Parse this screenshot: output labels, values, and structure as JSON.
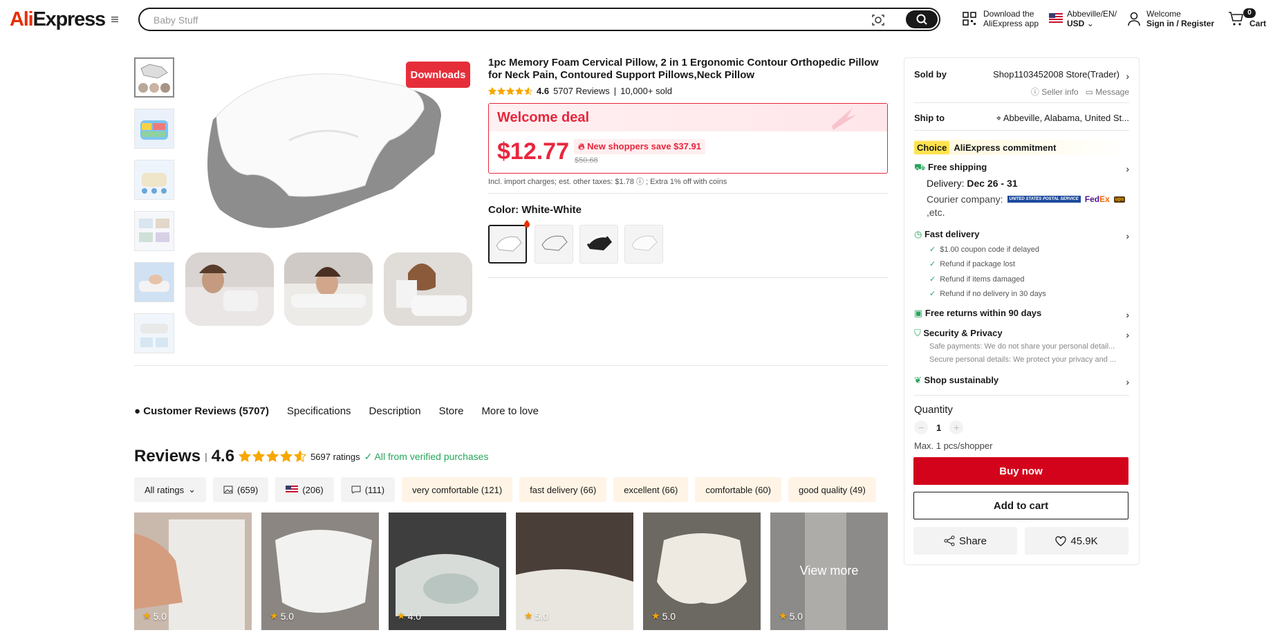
{
  "header": {
    "logo_a": "Ali",
    "logo_b": "Express",
    "search_placeholder": "Baby Stuff",
    "download_line1": "Download the",
    "download_line2": "AliExpress app",
    "region_line1": "Abbeville/EN/",
    "region_line2": "USD",
    "welcome": "Welcome",
    "signin": "Sign in / Register",
    "cart_count": "0",
    "cart_label": "Cart"
  },
  "gallery": {
    "downloads_label": "Downloads"
  },
  "product": {
    "title": "1pc Memory Foam Cervical Pillow, 2 in 1 Ergonomic Contour Orthopedic Pillow for Neck Pain, Contoured Support Pillows,Neck Pillow",
    "rating": "4.6",
    "rating_value": 4.6,
    "reviews": "5707 Reviews",
    "sold": "10,000+ sold",
    "deal_title": "Welcome deal",
    "price": "$12.77",
    "save_text": "New shoppers save $37.91",
    "old_price": "$50.68",
    "tax_note": "Incl. import charges; est. other taxes: $1.78 ⓘ ; Extra 1% off with coins",
    "color_label": "Color: White-White"
  },
  "tabs": [
    {
      "label": "Customer Reviews (5707)"
    },
    {
      "label": "Specifications"
    },
    {
      "label": "Description"
    },
    {
      "label": "Store"
    },
    {
      "label": "More to love"
    }
  ],
  "reviews": {
    "heading": "Reviews",
    "sep": "|",
    "rating": "4.6",
    "ratings_count": "5697 ratings",
    "verified": "All from verified purchases",
    "filters": [
      {
        "label": "All ratings",
        "kind": "select"
      },
      {
        "label": "(659)",
        "icon": "image-icon"
      },
      {
        "label": "(206)",
        "icon": "us-flag-icon"
      },
      {
        "label": "(111)",
        "icon": "comment-icon"
      },
      {
        "label": "very comfortable (121)"
      },
      {
        "label": "fast delivery (66)"
      },
      {
        "label": "excellent (66)"
      },
      {
        "label": "comfortable (60)"
      },
      {
        "label": "good quality (49)"
      }
    ],
    "photos": [
      {
        "score": "5.0"
      },
      {
        "score": "5.0"
      },
      {
        "score": "4.0"
      },
      {
        "score": "5.0"
      },
      {
        "score": "5.0"
      },
      {
        "score": "5.0"
      }
    ],
    "view_more": "View more"
  },
  "panel": {
    "sold_by_label": "Sold by",
    "store": "Shop1103452008 Store(Trader)",
    "seller_info": "Seller info",
    "message": "Message",
    "ship_to_label": "Ship to",
    "ship_to": "Abbeville, Alabama, United St...",
    "choice_badge": "Choice",
    "commitment": "AliExpress commitment",
    "free_shipping": "Free shipping",
    "delivery_label": "Delivery:",
    "delivery_dates": "Dec 26 - 31",
    "courier_label": "Courier company:",
    "courier_usps": "UNITED STATES POSTAL SERVICE",
    "courier_fedex_a": "Fed",
    "courier_fedex_b": "Ex",
    "courier_ups": "ups",
    "etc": ",etc.",
    "fast_delivery": "Fast delivery",
    "fast_items": [
      "$1.00 coupon code if delayed",
      "Refund if package lost",
      "Refund if items damaged",
      "Refund if no delivery in 30 days"
    ],
    "free_returns": "Free returns within 90 days",
    "security": "Security & Privacy",
    "security_1": "Safe payments: We do not share your personal detail...",
    "security_2": "Secure personal details: We protect your privacy and ...",
    "sustain": "Shop sustainably",
    "quantity_label": "Quantity",
    "quantity": "1",
    "max_note": "Max. 1 pcs/shopper",
    "buy_now": "Buy now",
    "add_to_cart": "Add to cart",
    "share": "Share",
    "wishlist": "45.9K"
  },
  "colors": {
    "accent": "#e8263c",
    "buy": "#d3031c",
    "star": "#f7a700",
    "green": "#26a65b"
  }
}
